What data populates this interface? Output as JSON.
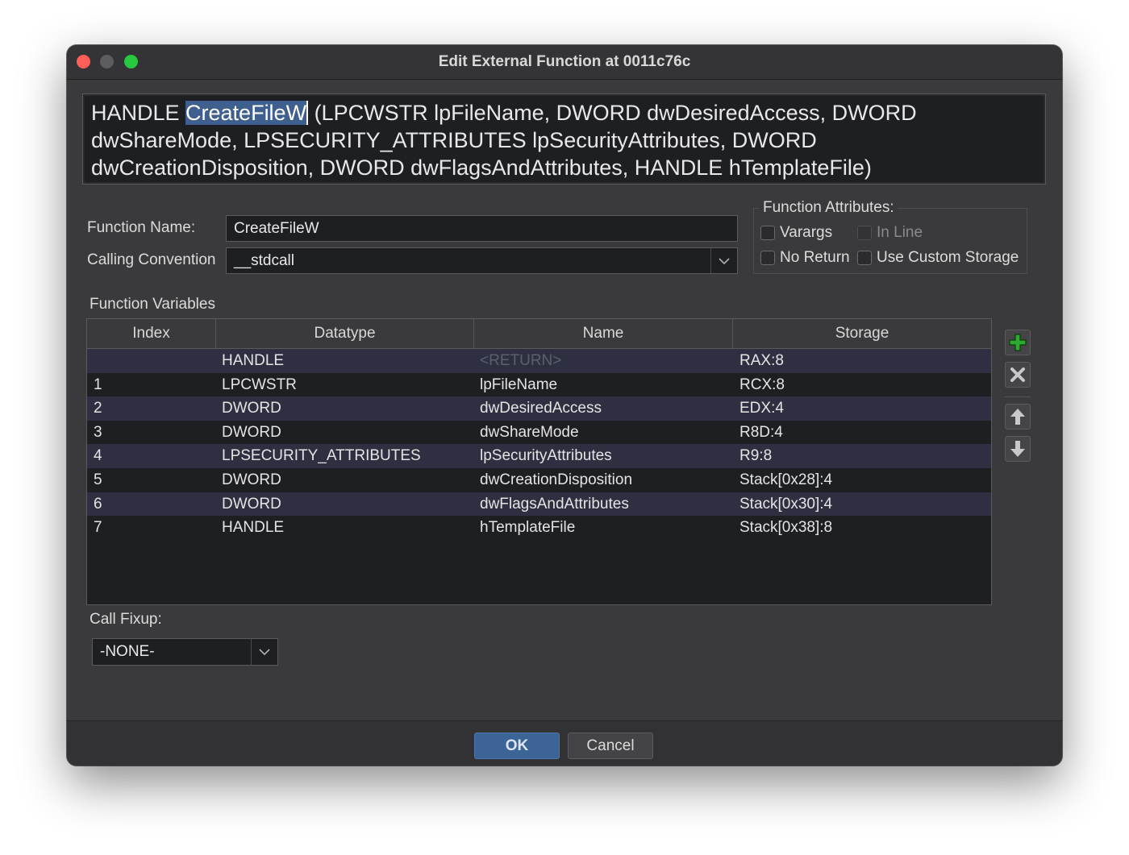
{
  "window": {
    "title": "Edit External Function at 0011c76c"
  },
  "signature": {
    "prefix": "HANDLE ",
    "selected": "CreateFileW",
    "suffix": " (LPCWSTR lpFileName, DWORD dwDesiredAccess, DWORD dwShareMode, LPSECURITY_ATTRIBUTES lpSecurityAttributes, DWORD dwCreationDisposition, DWORD dwFlagsAndAttributes, HANDLE hTemplateFile)"
  },
  "form": {
    "function_name_label": "Function Name:",
    "function_name_value": "CreateFileW",
    "calling_convention_label": "Calling Convention",
    "calling_convention_value": "__stdcall"
  },
  "attributes": {
    "label": "Function Attributes:",
    "varargs": {
      "label": "Varargs",
      "checked": false,
      "enabled": true
    },
    "in_line": {
      "label": "In Line",
      "checked": false,
      "enabled": false
    },
    "no_return": {
      "label": "No Return",
      "checked": false,
      "enabled": true
    },
    "custom_storage": {
      "label": "Use Custom Storage",
      "checked": false,
      "enabled": true
    }
  },
  "variables": {
    "label": "Function Variables",
    "columns": [
      "Index",
      "Datatype",
      "Name",
      "Storage"
    ],
    "rows": [
      {
        "index": "",
        "datatype": "HANDLE",
        "name": "<RETURN>",
        "storage": "RAX:8"
      },
      {
        "index": "1",
        "datatype": "LPCWSTR",
        "name": "lpFileName",
        "storage": "RCX:8"
      },
      {
        "index": "2",
        "datatype": "DWORD",
        "name": "dwDesiredAccess",
        "storage": "EDX:4"
      },
      {
        "index": "3",
        "datatype": "DWORD",
        "name": "dwShareMode",
        "storage": "R8D:4"
      },
      {
        "index": "4",
        "datatype": "LPSECURITY_ATTRIBUTES",
        "name": "lpSecurityAttributes",
        "storage": "R9:8"
      },
      {
        "index": "5",
        "datatype": "DWORD",
        "name": "dwCreationDisposition",
        "storage": "Stack[0x28]:4"
      },
      {
        "index": "6",
        "datatype": "DWORD",
        "name": "dwFlagsAndAttributes",
        "storage": "Stack[0x30]:4"
      },
      {
        "index": "7",
        "datatype": "HANDLE",
        "name": "hTemplateFile",
        "storage": "Stack[0x38]:8"
      }
    ]
  },
  "side_buttons": {
    "add": "plus-icon",
    "remove": "x-icon",
    "up": "arrow-up-icon",
    "down": "arrow-down-icon"
  },
  "call_fixup": {
    "label": "Call Fixup:",
    "value": "-NONE-"
  },
  "buttons": {
    "ok": "OK",
    "cancel": "Cancel"
  },
  "colors": {
    "accent": "#3c6496",
    "selection": "#3f5f8f",
    "row_alt": "#2e3042",
    "add_icon": "#2ea82e"
  }
}
